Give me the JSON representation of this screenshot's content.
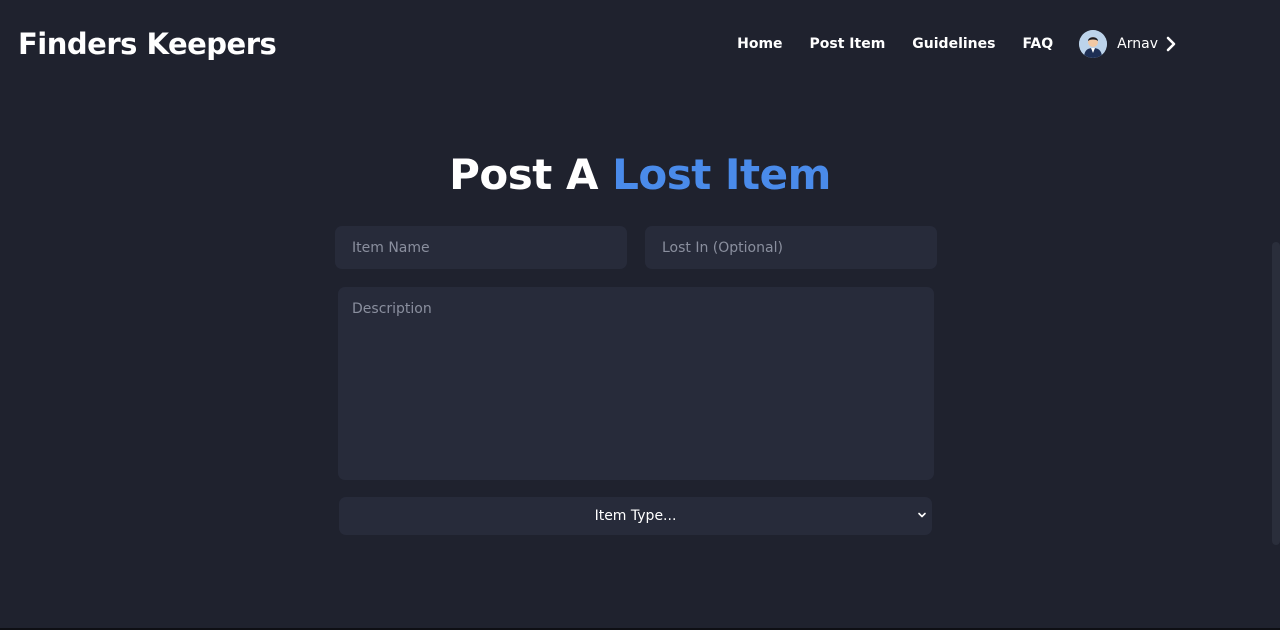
{
  "header": {
    "brand": "Finders Keepers",
    "nav": {
      "home": "Home",
      "post_item": "Post Item",
      "guidelines": "Guidelines",
      "faq": "FAQ"
    },
    "profile": {
      "name": "Arnav",
      "avatar_icon": "user-avatar-icon",
      "chevron_icon": "chevron-right-icon"
    }
  },
  "main": {
    "title_part1": "Post A ",
    "title_accent": "Lost Item",
    "form": {
      "item_name": {
        "value": "",
        "placeholder": "Item Name"
      },
      "lost_in": {
        "value": "",
        "placeholder": "Lost In (Optional)"
      },
      "description": {
        "value": "",
        "placeholder": "Description"
      },
      "item_type": {
        "selected": "Item Type...",
        "arrow_icon": "chevron-down-icon"
      }
    }
  },
  "colors": {
    "background": "#1f222e",
    "field_background": "#272b3a",
    "accent": "#4a8bea",
    "placeholder": "#8a8f9e"
  }
}
